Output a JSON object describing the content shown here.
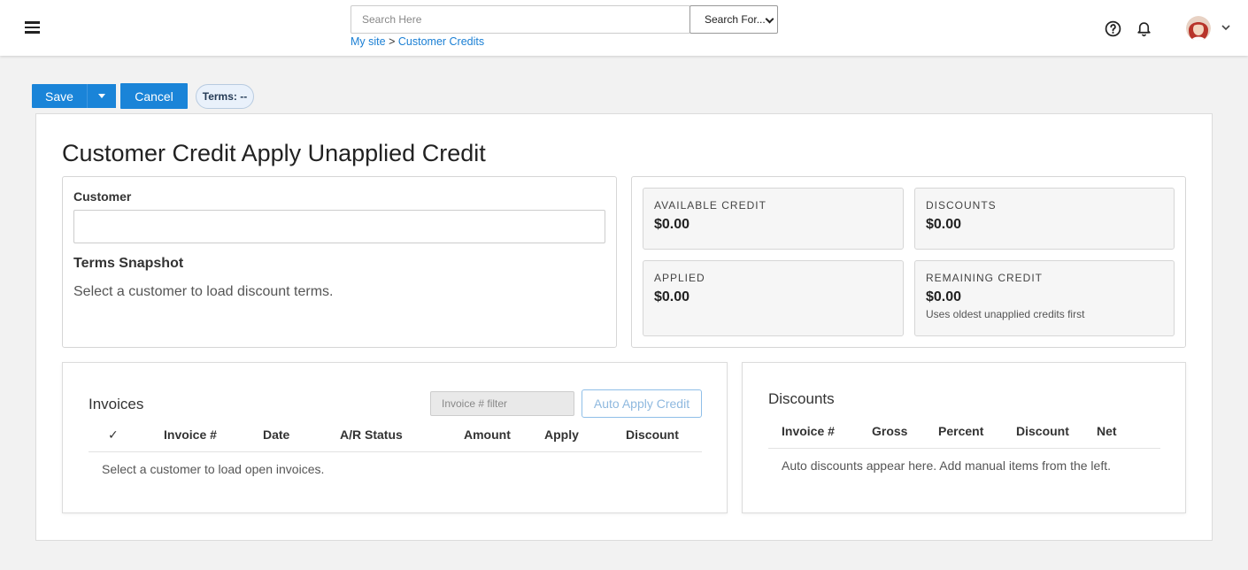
{
  "header": {
    "search_placeholder": "Search Here",
    "search_select": "Search For...",
    "breadcrumb": {
      "root": "My site",
      "separator": ">",
      "current": "Customer Credits"
    }
  },
  "actions": {
    "save_label": "Save",
    "cancel_label": "Cancel",
    "terms_badge": "Terms: --"
  },
  "page": {
    "title": "Customer Credit Apply Unapplied Credit"
  },
  "customer": {
    "label": "Customer",
    "value": "",
    "snapshot_title": "Terms Snapshot",
    "snapshot_text": "Select a customer to load discount terms."
  },
  "stats": {
    "available_label": "AVAILABLE CREDIT",
    "available_value": "$0.00",
    "discounts_label": "DISCOUNTS",
    "discounts_value": "$0.00",
    "applied_label": "APPLIED",
    "applied_value": "$0.00",
    "remaining_label": "REMAINING CREDIT",
    "remaining_value": "$0.00",
    "remaining_note": "Uses oldest unapplied credits first"
  },
  "invoices": {
    "title": "Invoices",
    "filter_placeholder": "Invoice # filter",
    "auto_apply_label": "Auto Apply Credit",
    "columns": [
      "✓",
      "Invoice #",
      "Date",
      "A/R Status",
      "Amount",
      "Apply",
      "Discount"
    ],
    "empty_text": "Select a customer to load open invoices."
  },
  "discounts": {
    "title": "Discounts",
    "columns": [
      "Invoice #",
      "Gross",
      "Percent",
      "Discount",
      "Net"
    ],
    "empty_text": "Auto discounts appear here. Add manual items from the left."
  },
  "colors": {
    "primary": "#1a84d8",
    "link": "#1a7fd4",
    "background": "#f2f2f2"
  }
}
